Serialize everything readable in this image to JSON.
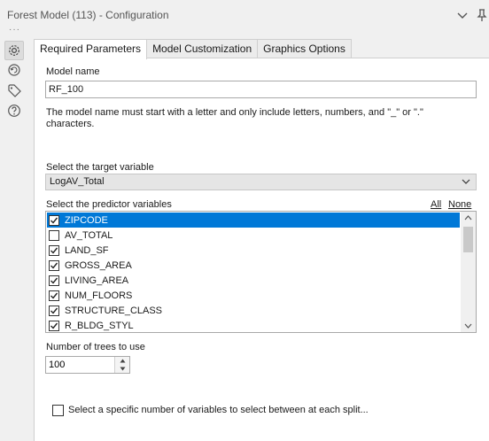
{
  "window": {
    "title": "Forest Model (113) - Configuration"
  },
  "tabs": [
    {
      "label": "Required Parameters",
      "active": true
    },
    {
      "label": "Model Customization",
      "active": false
    },
    {
      "label": "Graphics Options",
      "active": false
    }
  ],
  "rail": [
    "gear-icon",
    "refresh-icon",
    "tag-icon",
    "help-icon"
  ],
  "model_name": {
    "label": "Model name",
    "value": "RF_100",
    "help": "The model name must start with a letter and only include letters, numbers, and \"_\" or \".\" characters."
  },
  "target": {
    "label": "Select the target variable",
    "value": "LogAV_Total"
  },
  "predictors": {
    "label": "Select the predictor variables",
    "all_label": "All",
    "none_label": "None",
    "items": [
      {
        "name": "ZIPCODE",
        "checked": true,
        "selected": true
      },
      {
        "name": "AV_TOTAL",
        "checked": false,
        "selected": false
      },
      {
        "name": "LAND_SF",
        "checked": true,
        "selected": false
      },
      {
        "name": "GROSS_AREA",
        "checked": true,
        "selected": false
      },
      {
        "name": "LIVING_AREA",
        "checked": true,
        "selected": false
      },
      {
        "name": "NUM_FLOORS",
        "checked": true,
        "selected": false
      },
      {
        "name": "STRUCTURE_CLASS",
        "checked": true,
        "selected": false
      },
      {
        "name": "R_BLDG_STYL",
        "checked": true,
        "selected": false
      }
    ]
  },
  "trees": {
    "label": "Number of trees to use",
    "value": "100"
  },
  "split_option": {
    "label": "Select a specific number of variables to select between at each split...",
    "checked": false
  },
  "colors": {
    "accent": "#0078d7",
    "panel": "#ffffff",
    "chrome": "#f0f0f0"
  }
}
